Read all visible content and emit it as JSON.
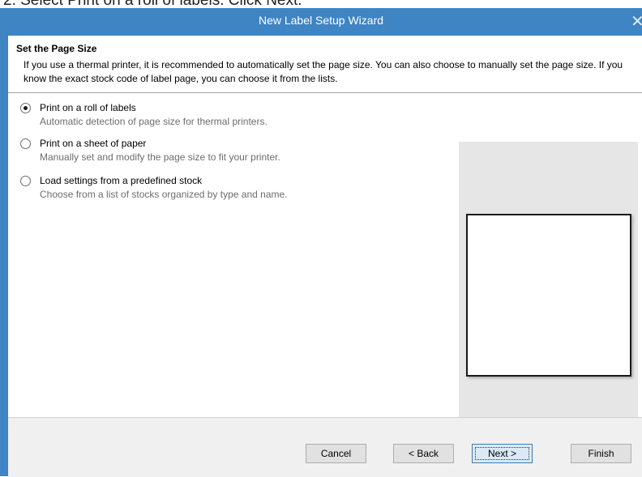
{
  "caption": "2. Select Print on a roll of labels. Click Next.",
  "window": {
    "title": "New Label Setup Wizard",
    "close_glyph": "✕"
  },
  "header": {
    "title": "Set the Page Size",
    "description": "If you use a thermal printer, it is recommended to automatically set the page size. You can also choose to manually set the page size. If you know the exact stock code of label page, you can choose it from the lists."
  },
  "options": [
    {
      "label": "Print on a roll of labels",
      "description": "Automatic detection of page size for thermal printers.",
      "selected": true
    },
    {
      "label": "Print on a sheet of paper",
      "description": "Manually set and modify the page size to fit your printer.",
      "selected": false
    },
    {
      "label": "Load settings from a predefined stock",
      "description": "Choose from a list of stocks organized by type and name.",
      "selected": false
    }
  ],
  "buttons": {
    "cancel": "Cancel",
    "back": "< Back",
    "next": "Next >",
    "finish": "Finish"
  },
  "colors": {
    "titlebar": "#3f84c3",
    "dialog_background": "#f0f0f0",
    "preview_background": "#e6e6e6"
  }
}
